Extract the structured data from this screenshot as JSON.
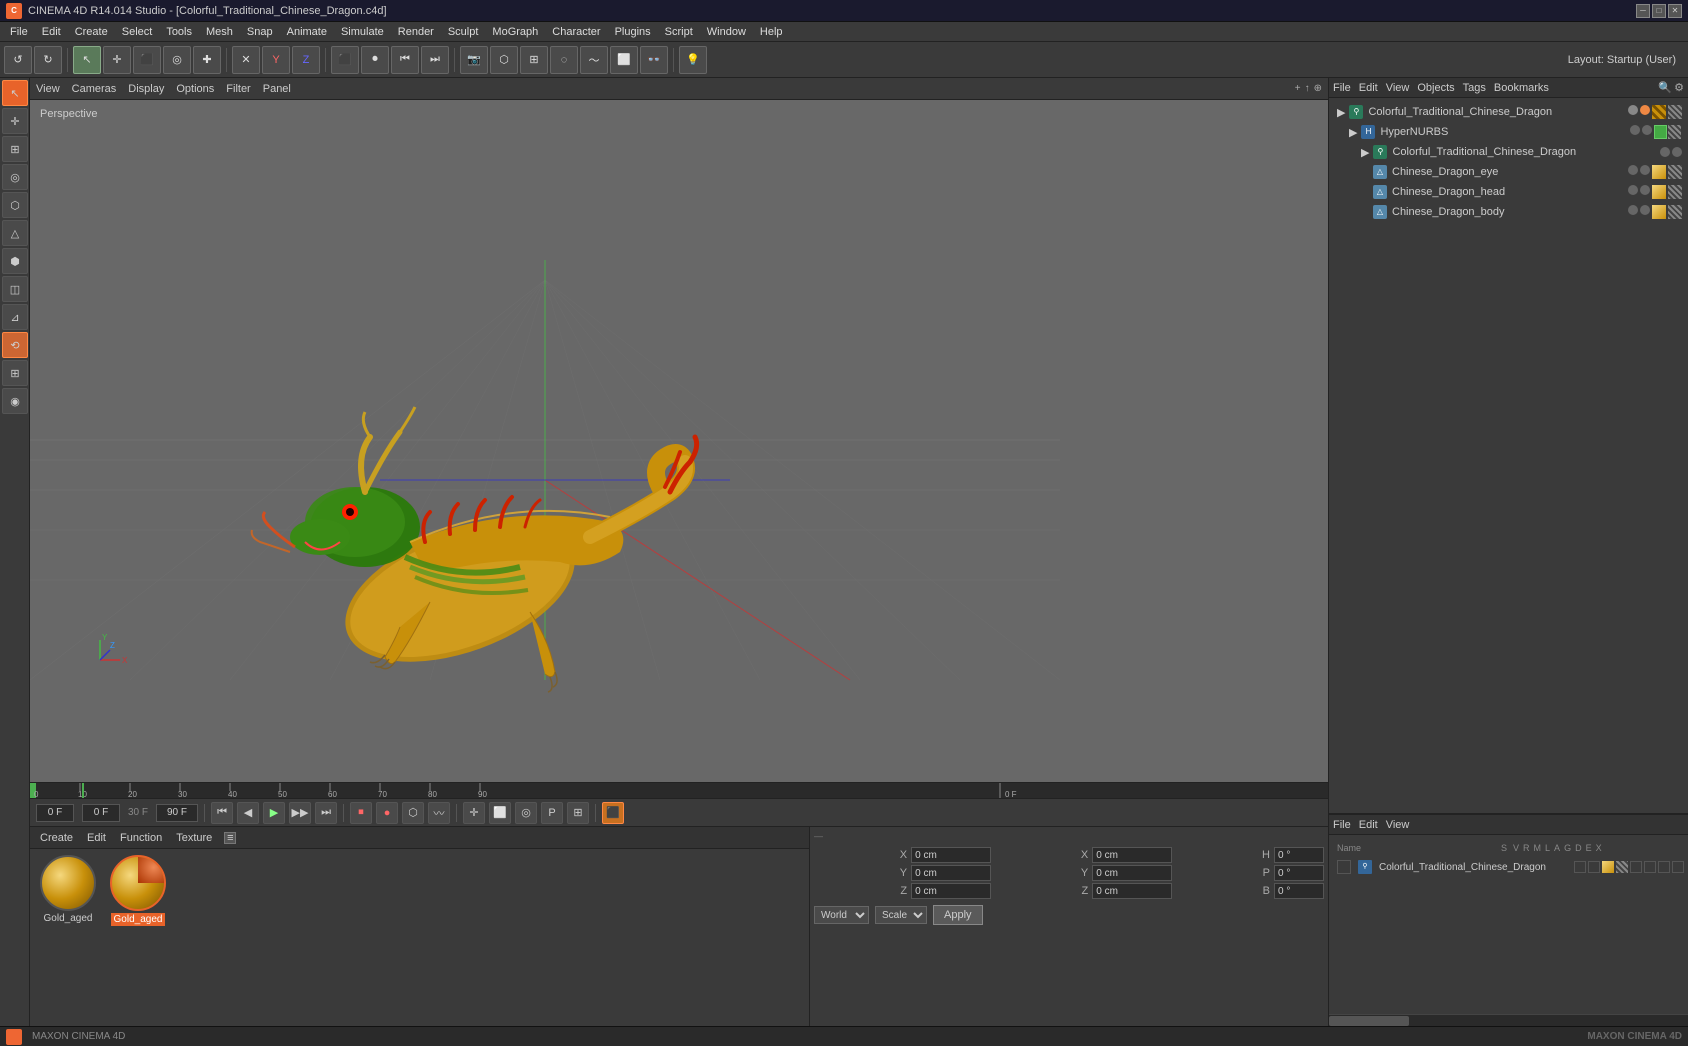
{
  "titlebar": {
    "icon": "C4D",
    "title": "CINEMA 4D R14.014 Studio - [Colorful_Traditional_Chinese_Dragon.c4d]",
    "minimize": "─",
    "maximize": "□",
    "close": "✕"
  },
  "menubar": {
    "items": [
      "File",
      "Edit",
      "Create",
      "Select",
      "Tools",
      "Mesh",
      "Snap",
      "Animate",
      "Simulate",
      "Render",
      "Sculpt",
      "MoGraph",
      "Character",
      "Plugins",
      "Script",
      "Window",
      "Help"
    ]
  },
  "toolbar": {
    "undo_label": "↺",
    "redo_label": "↻",
    "layout_label": "Layout:  Startup (User)"
  },
  "viewport": {
    "menu_items": [
      "View",
      "Cameras",
      "Display",
      "Options",
      "Filter",
      "Panel"
    ],
    "perspective_label": "Perspective",
    "corner_icons": [
      "+",
      "↑",
      "⊕"
    ]
  },
  "left_tools": {
    "buttons": [
      "↖",
      "⊕",
      "□",
      "◎",
      "⊞",
      "△",
      "⬡",
      "◫",
      "⊿",
      "⟲",
      "⊞",
      "◉"
    ]
  },
  "timeline": {
    "markers": [
      "0",
      "10",
      "20",
      "30",
      "40",
      "50",
      "60",
      "70",
      "80",
      "90"
    ],
    "current_frame": "0 F",
    "start_frame": "0 F",
    "end_frame": "90 F",
    "fps": "30 F"
  },
  "transport": {
    "frame_start": "0 F",
    "frame_current": "0 F",
    "fps_label": "30 F",
    "end_frame": "90 F"
  },
  "material_panel": {
    "menu_items": [
      "Create",
      "Edit",
      "Function",
      "Texture"
    ],
    "materials": [
      {
        "name": "Gold_aged",
        "type": "gold",
        "selected": false
      },
      {
        "name": "Gold_aged",
        "type": "gold-red",
        "selected": true
      }
    ]
  },
  "coord_panel": {
    "x_label": "X",
    "y_label": "Y",
    "z_label": "Z",
    "x_val": "0 cm",
    "y_val": "0 cm",
    "z_val": "0 cm",
    "ex_label": "X",
    "ey_label": "Y",
    "ez_label": "Z",
    "ex_val": "0 cm",
    "ey_val": "0 cm",
    "ez_val": "0 cm",
    "h_label": "H",
    "p_label": "P",
    "b_label": "B",
    "h_val": "0 °",
    "p_val": "0 °",
    "b_val": "0 °",
    "world_label": "World",
    "scale_label": "Scale",
    "apply_label": "Apply"
  },
  "object_manager": {
    "header_items": [
      "File",
      "Edit",
      "View",
      "Objects",
      "Tags",
      "Bookmarks"
    ],
    "objects": [
      {
        "name": "Colorful_Traditional_Chinese_Dragon",
        "level": 0,
        "icon": "🎬",
        "has_dot": true,
        "dot_color": "red"
      },
      {
        "name": "HyperNURBS",
        "level": 1,
        "icon": "⚙",
        "has_dot": true,
        "dot_color": "gray"
      },
      {
        "name": "Colorful_Traditional_Chinese_Dragon",
        "level": 2,
        "icon": "🎬",
        "has_dot": true,
        "dot_color": "gray"
      },
      {
        "name": "Chinese_Dragon_eye",
        "level": 3,
        "icon": "△",
        "has_dot": true,
        "dot_color": "gray"
      },
      {
        "name": "Chinese_Dragon_head",
        "level": 3,
        "icon": "△",
        "has_dot": true,
        "dot_color": "gray"
      },
      {
        "name": "Chinese_Dragon_body",
        "level": 3,
        "icon": "△",
        "has_dot": true,
        "dot_color": "gray"
      }
    ]
  },
  "prop_panel": {
    "header_items": [
      "File",
      "Edit",
      "View"
    ],
    "name_label": "Name",
    "col_labels": [
      "S",
      "V",
      "R",
      "M",
      "L",
      "A",
      "G",
      "D",
      "E",
      "X"
    ],
    "object_name": "Colorful_Traditional_Chinese_Dragon"
  },
  "status_bar": {
    "logo": "MAXON CINEMA 4D"
  }
}
